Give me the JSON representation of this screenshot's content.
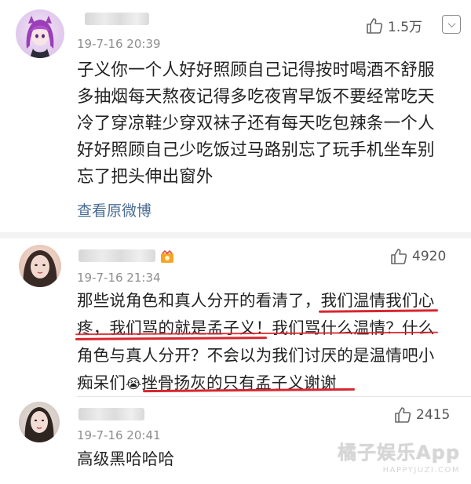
{
  "comments": [
    {
      "username": "",
      "time": "19-7-16 20:39",
      "likes": "1.5万",
      "lines": [
        "子义你一个人好好照顾自己记得按时喝酒不舒服",
        "多抽烟每天熬夜记得多吃夜宵早饭不要经常吃天",
        "冷了穿凉鞋少穿双袜子还有每天吃包辣条一个人",
        "好好照顾自己少吃饭过马路别忘了玩手机坐车别",
        "忘了把头伸出窗外"
      ],
      "origin_link": "查看原微博"
    },
    {
      "username": "",
      "time": "19-7-16 21:34",
      "likes": "4920",
      "line1_a": "那些说角色和真人分开的看清了，",
      "line1_b": "我们温情我们心",
      "line2_a": "疼，我们骂的就是孟子义！",
      "line2_b": "我们骂什么温情？什么",
      "line3": "角色与真人分开？不会以为我们讨厌的是温情吧小",
      "line4_a": "痴呆们",
      "line4_emoji": "😭",
      "line4_b": "挫骨扬灰的只有孟子义谢谢"
    },
    {
      "username": "",
      "time": "19-7-16 20:41",
      "likes": "2415",
      "text": "高级黑哈哈哈"
    }
  ],
  "watermark": {
    "main": "橘子娱乐App",
    "sub": "HAPPYJUZI.COM"
  },
  "colors": {
    "link": "#4a6c93",
    "underline": "#d9262f",
    "separator": "#f3f3f3"
  }
}
